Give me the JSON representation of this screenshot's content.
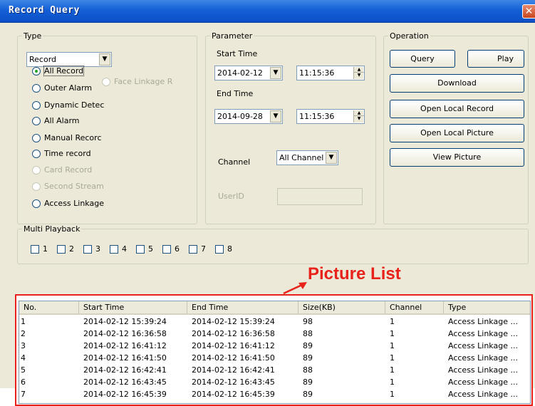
{
  "window": {
    "title": "Record Query",
    "close_icon": "close-icon"
  },
  "type_group": {
    "legend": "Type",
    "select_value": "Record",
    "options": [
      {
        "label": "All Record",
        "checked": true,
        "enabled": true
      },
      {
        "label": "Outer Alarm",
        "checked": false,
        "enabled": true
      },
      {
        "label": "Dynamic Detec",
        "checked": false,
        "enabled": true
      },
      {
        "label": "All Alarm",
        "checked": false,
        "enabled": true
      },
      {
        "label": "Manual Recorc",
        "checked": false,
        "enabled": true
      },
      {
        "label": "Time record",
        "checked": false,
        "enabled": true
      },
      {
        "label": "Card Record",
        "checked": false,
        "enabled": false
      },
      {
        "label": "Second Stream",
        "checked": false,
        "enabled": false
      },
      {
        "label": "Access Linkage",
        "checked": false,
        "enabled": true
      }
    ],
    "face_linkage": "Face Linkage R"
  },
  "parameter_group": {
    "legend": "Parameter",
    "start_label": "Start Time",
    "start_date": "2014-02-12",
    "start_time": "11:15:36",
    "end_label": "End Time",
    "end_date": "2014-09-28",
    "end_time": "11:15:36",
    "channel_label": "Channel",
    "channel_value": "All Channel",
    "userid_label": "UserID",
    "userid_value": ""
  },
  "operation_group": {
    "legend": "Operation",
    "buttons": {
      "query": "Query",
      "play": "Play",
      "download": "Download",
      "open_local_record": "Open Local Record",
      "open_local_picture": "Open Local Picture",
      "view_picture": "View Picture"
    }
  },
  "multi_playback": {
    "legend": "Multi Playback",
    "channels": [
      "1",
      "2",
      "3",
      "4",
      "5",
      "6",
      "7",
      "8"
    ]
  },
  "annotation": {
    "text": "Picture List",
    "color": "#e8221b"
  },
  "picture_list": {
    "columns": [
      "No.",
      "Start Time",
      "End Time",
      "Size(KB)",
      "Channel",
      "Type"
    ],
    "rows": [
      [
        "1",
        "2014-02-12 15:39:24",
        "2014-02-12 15:39:24",
        "98",
        "1",
        "Access Linkage ..."
      ],
      [
        "2",
        "2014-02-12 16:36:58",
        "2014-02-12 16:36:58",
        "88",
        "1",
        "Access Linkage ..."
      ],
      [
        "3",
        "2014-02-12 16:41:12",
        "2014-02-12 16:41:12",
        "89",
        "1",
        "Access Linkage ..."
      ],
      [
        "4",
        "2014-02-12 16:41:50",
        "2014-02-12 16:41:50",
        "89",
        "1",
        "Access Linkage ..."
      ],
      [
        "5",
        "2014-02-12 16:42:41",
        "2014-02-12 16:42:41",
        "88",
        "1",
        "Access Linkage ..."
      ],
      [
        "6",
        "2014-02-12 16:43:45",
        "2014-02-12 16:43:45",
        "89",
        "1",
        "Access Linkage ..."
      ],
      [
        "7",
        "2014-02-12 16:45:39",
        "2014-02-12 16:45:39",
        "89",
        "1",
        "Access Linkage ..."
      ]
    ]
  }
}
